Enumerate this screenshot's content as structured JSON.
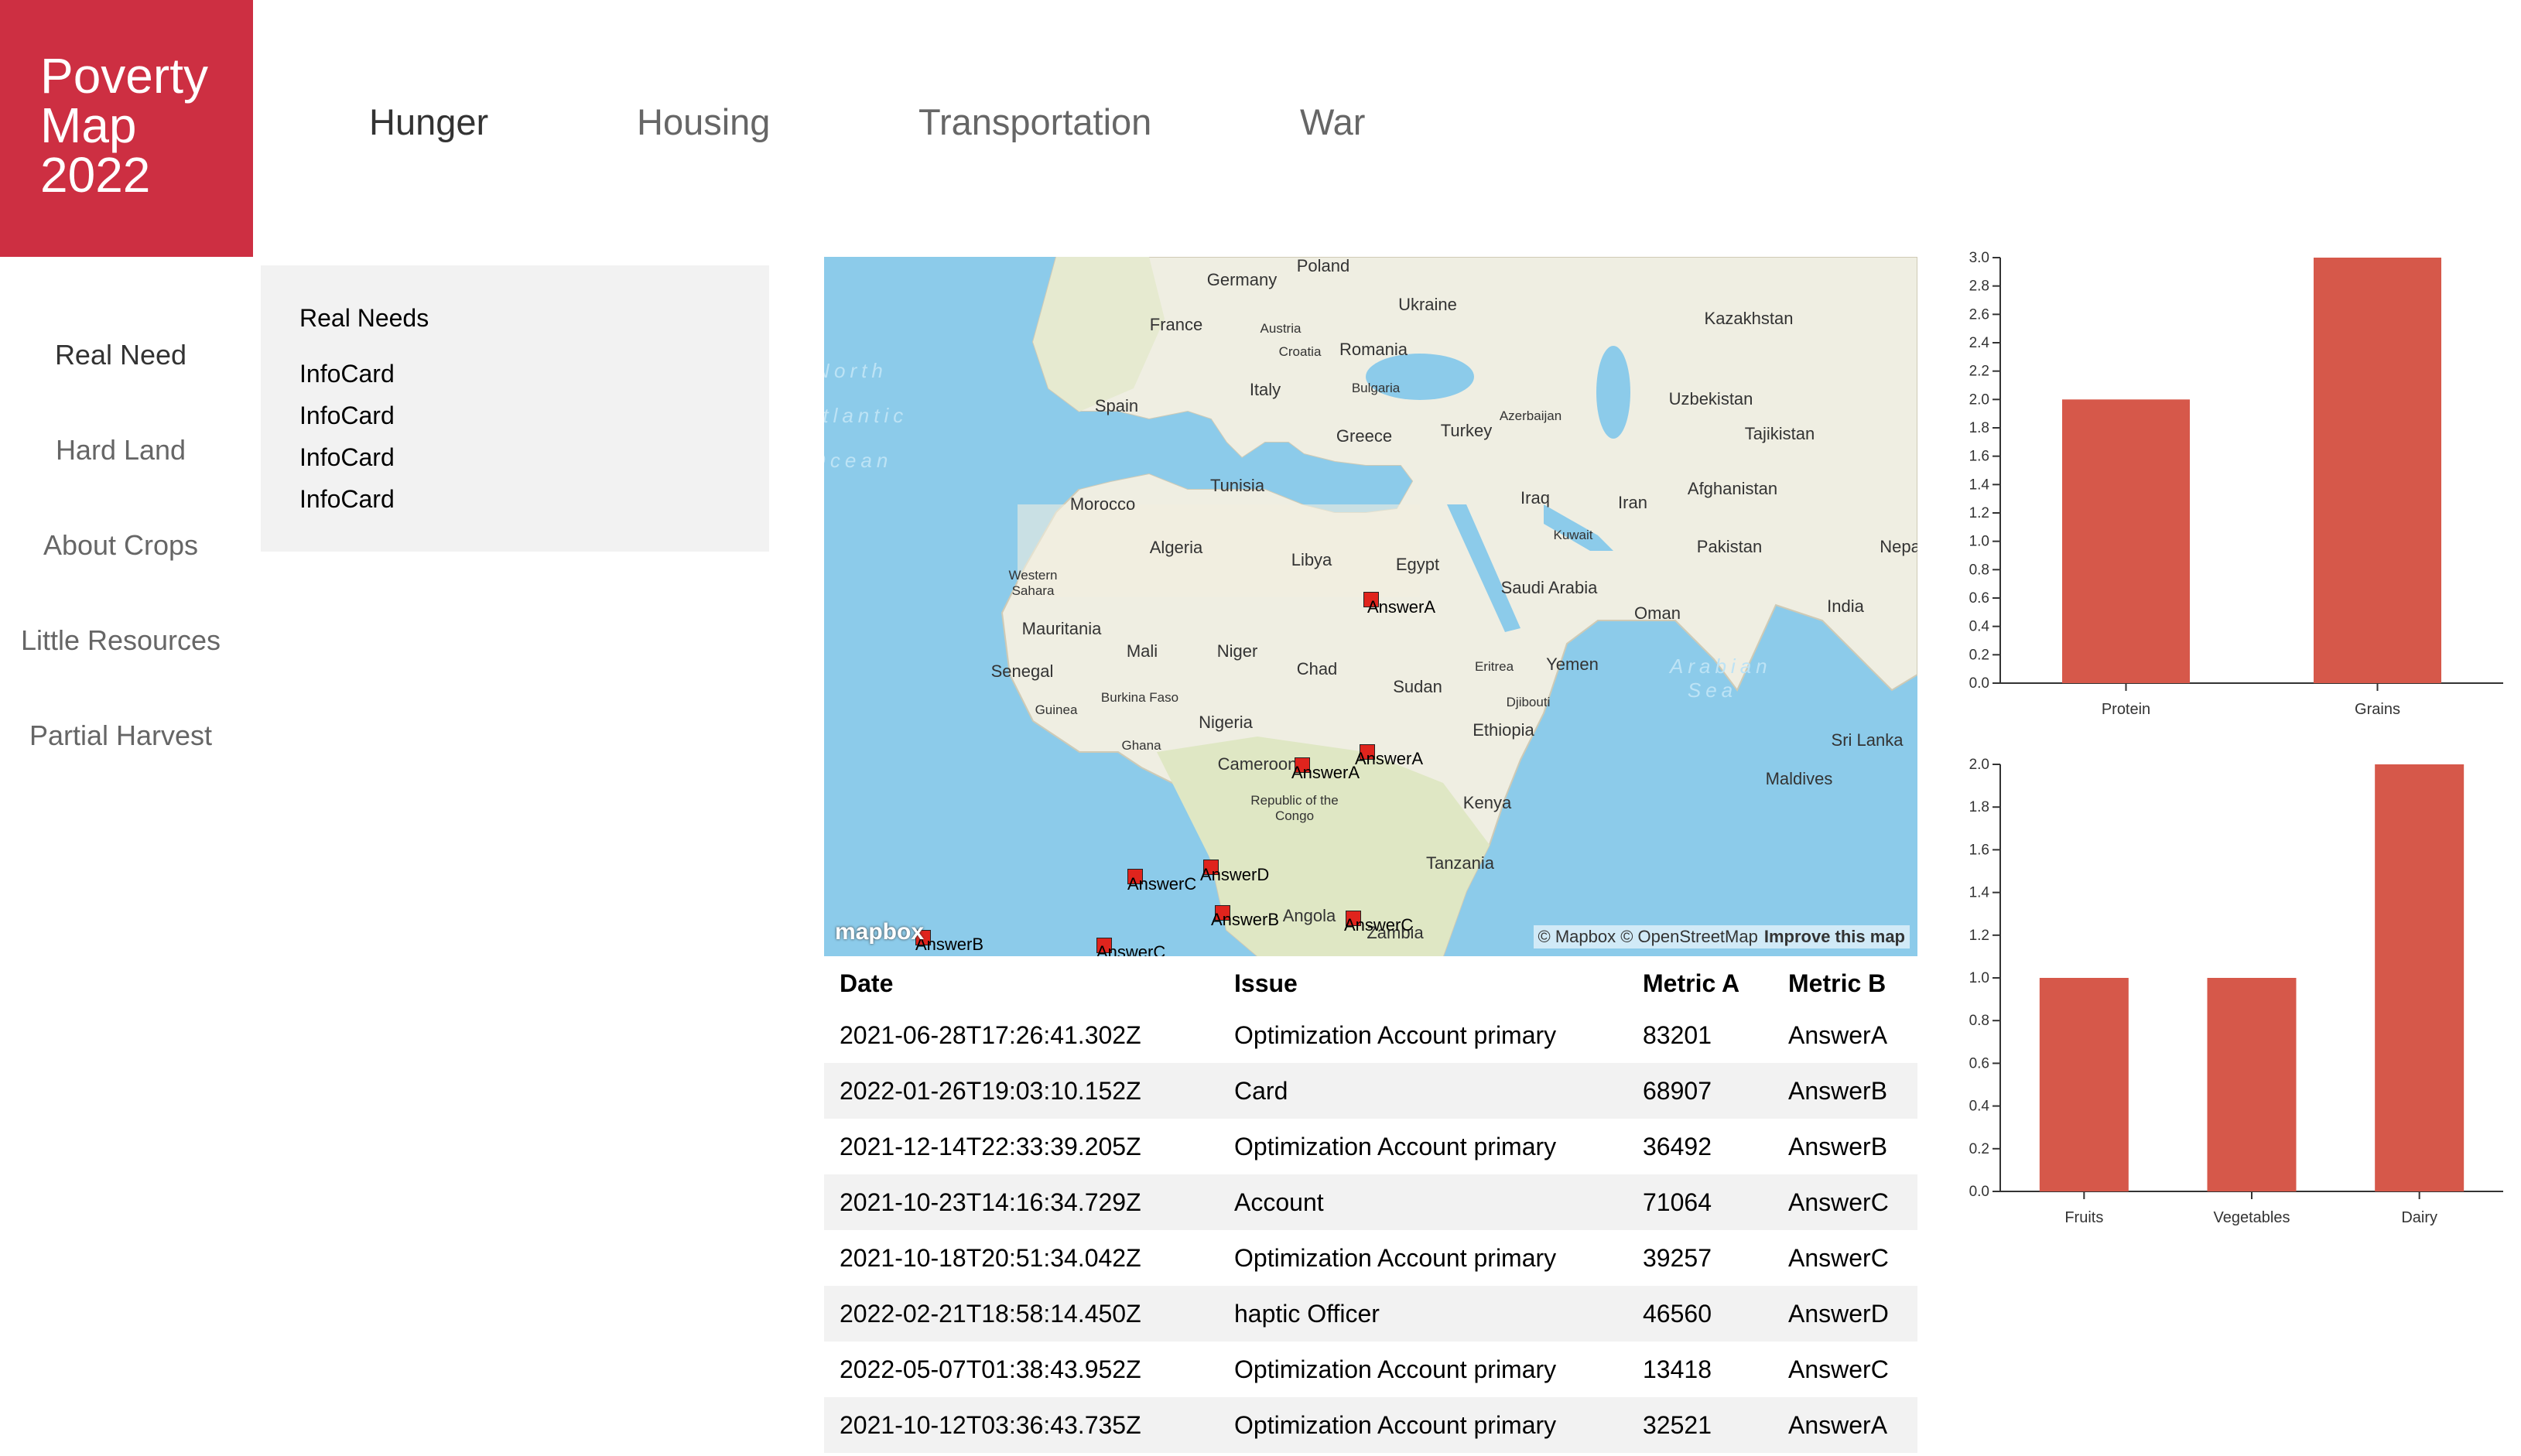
{
  "app": {
    "title_lines": [
      "Poverty",
      "Map",
      "2022"
    ]
  },
  "topnav": {
    "items": [
      "Hunger",
      "Housing",
      "Transportation",
      "War"
    ],
    "active": 0
  },
  "sidenav": {
    "items": [
      "Real Need",
      "Hard Land",
      "About Crops",
      "Little Resources",
      "Partial Harvest"
    ],
    "active": 0
  },
  "infopanel": {
    "title": "Real Needs",
    "cards": [
      "InfoCard",
      "InfoCard",
      "InfoCard",
      "InfoCard"
    ]
  },
  "map": {
    "labels": [
      "Poland",
      "Germany",
      "Ukraine",
      "Kazakhstan",
      "France",
      "Austria",
      "Croatia",
      "Romania",
      "Bulgaria",
      "Italy",
      "Spain",
      "Greece",
      "Turkey",
      "Azerbaijan",
      "Uzbekistan",
      "Tajikistan",
      "Tunisia",
      "Morocco",
      "Algeria",
      "Libya",
      "Egypt",
      "Iraq",
      "Iran",
      "Afghanistan",
      "Kuwait",
      "Pakistan",
      "Nepal",
      "Saudi Arabia",
      "Western Sahara",
      "Mauritania",
      "Mali",
      "Niger",
      "Senegal",
      "Chad",
      "Sudan",
      "Eritrea",
      "Yemen",
      "Oman",
      "India",
      "Guinea",
      "Burkina Faso",
      "Nigeria",
      "Ghana",
      "Djibouti",
      "Ethiopia",
      "Cameroon",
      "Republic of the Congo",
      "Kenya",
      "Tanzania",
      "Angola",
      "Zambia",
      "Sri Lanka",
      "Maldives",
      "Arabian Sea",
      "North Atlantic Ocean"
    ],
    "markers": [
      "AnswerA",
      "AnswerA",
      "AnswerA",
      "AnswerB",
      "AnswerB",
      "AnswerC",
      "AnswerC",
      "AnswerC",
      "AnswerD"
    ],
    "attribution": "© Mapbox © OpenStreetMap",
    "improve_link": "Improve this map",
    "logo": "mapbox"
  },
  "table": {
    "columns": [
      "Date",
      "Issue",
      "Metric A",
      "Metric B"
    ],
    "rows": [
      [
        "2021-06-28T17:26:41.302Z",
        "Optimization Account primary",
        "83201",
        "AnswerA"
      ],
      [
        "2022-01-26T19:03:10.152Z",
        "Card",
        "68907",
        "AnswerB"
      ],
      [
        "2021-12-14T22:33:39.205Z",
        "Optimization Account primary",
        "36492",
        "AnswerB"
      ],
      [
        "2021-10-23T14:16:34.729Z",
        "Account",
        "71064",
        "AnswerC"
      ],
      [
        "2021-10-18T20:51:34.042Z",
        "Optimization Account primary",
        "39257",
        "AnswerC"
      ],
      [
        "2022-02-21T18:58:14.450Z",
        "haptic Officer",
        "46560",
        "AnswerD"
      ],
      [
        "2022-05-07T01:38:43.952Z",
        "Optimization Account primary",
        "13418",
        "AnswerC"
      ],
      [
        "2021-10-12T03:36:43.735Z",
        "Optimization Account primary",
        "32521",
        "AnswerA"
      ]
    ]
  },
  "colors": {
    "brand": "#cd2f42",
    "bar": "#d6584a"
  },
  "chart_data": [
    {
      "type": "bar",
      "categories": [
        "Protein",
        "Grains"
      ],
      "values": [
        2.0,
        3.0
      ],
      "ylim": [
        0,
        3.0
      ],
      "yticks_step": 0.2,
      "title": "",
      "xlabel": "",
      "ylabel": ""
    },
    {
      "type": "bar",
      "categories": [
        "Fruits",
        "Vegetables",
        "Dairy"
      ],
      "values": [
        1.0,
        1.0,
        2.0
      ],
      "ylim": [
        0,
        2.0
      ],
      "yticks_step": 0.2,
      "title": "",
      "xlabel": "",
      "ylabel": ""
    }
  ]
}
